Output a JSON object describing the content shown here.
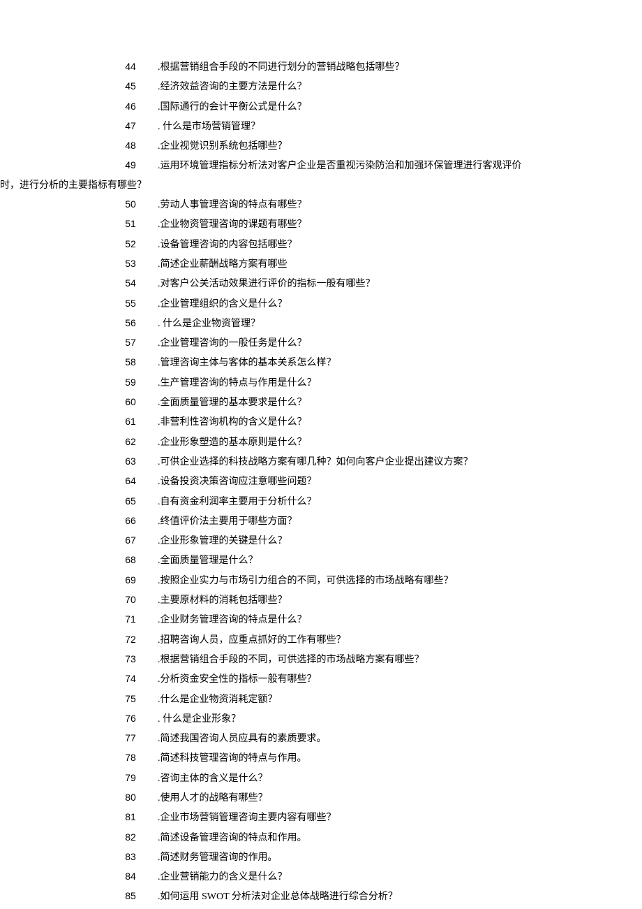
{
  "questions": [
    {
      "num": "44",
      "text": ".根据营销组合手段的不同进行划分的营销战略包括哪些？"
    },
    {
      "num": "45",
      "text": ".经济效益咨询的主要方法是什么？"
    },
    {
      "num": "46",
      "text": ".国际通行的会计平衡公式是什么？"
    },
    {
      "num": "47",
      "text": ". 什么是市场营销管理？"
    },
    {
      "num": "48",
      "text": ".企业视觉识别系统包括哪些？"
    },
    {
      "num": "49",
      "wrap": true,
      "wrap_prefix": "时，",
      "first_line": ".运用环境管理指标分析法对客户企业是否重视污染防治和加强环保管理进行客观评价",
      "second_line": "进行分析的主要指标有哪些？"
    },
    {
      "num": "50",
      "text": ".劳动人事管理咨询的特点有哪些？"
    },
    {
      "num": "51",
      "text": ".企业物资管理咨询的课题有哪些？"
    },
    {
      "num": "52",
      "text": ".设备管理咨询的内容包括哪些？"
    },
    {
      "num": "53",
      "text": ".简述企业薪酬战略方案有哪些"
    },
    {
      "num": "54",
      "text": ".对客户公关活动效果进行评价的指标一般有哪些？"
    },
    {
      "num": "55",
      "text": ".企业管理组织的含义是什么？"
    },
    {
      "num": "56",
      "text": ". 什么是企业物资管理？"
    },
    {
      "num": "57",
      "text": ".企业管理咨询的一般任务是什么？"
    },
    {
      "num": "58",
      "text": ".管理咨询主体与客体的基本关系怎么样？"
    },
    {
      "num": "59",
      "text": ".生产管理咨询的特点与作用是什么？"
    },
    {
      "num": "60",
      "text": ".全面质量管理的基本要求是什么？"
    },
    {
      "num": "61",
      "text": ".非营利性咨询机构的含义是什么？"
    },
    {
      "num": "62",
      "text": ".企业形象塑造的基本原则是什么？"
    },
    {
      "num": "63",
      "text": ".可供企业选择的科技战略方案有哪几种？如何向客户企业提出建议方案？"
    },
    {
      "num": "64",
      "text": ".设备投资决策咨询应注意哪些问题？"
    },
    {
      "num": "65",
      "text": ".自有资金利润率主要用于分析什么？"
    },
    {
      "num": "66",
      "text": ".终值评价法主要用于哪些方面？"
    },
    {
      "num": "67",
      "text": ".企业形象管理的关键是什么？"
    },
    {
      "num": "68",
      "text": ".全面质量管理是什么？"
    },
    {
      "num": "69",
      "text": ".按照企业实力与市场引力组合的不同，可供选择的市场战略有哪些？"
    },
    {
      "num": "70",
      "text": ".主要原材料的消耗包括哪些？"
    },
    {
      "num": "71",
      "text": ".企业财务管理咨询的特点是什么？"
    },
    {
      "num": "72",
      "text": ".招聘咨询人员，应重点抓好的工作有哪些？"
    },
    {
      "num": "73",
      "text": ".根据营销组合手段的不同，可供选择的市场战略方案有哪些？"
    },
    {
      "num": "74",
      "text": ".分析资金安全性的指标一般有哪些？"
    },
    {
      "num": "75",
      "text": ".什么是企业物资消耗定额？"
    },
    {
      "num": "76",
      "text": ". 什么是企业形象？"
    },
    {
      "num": "77",
      "text": ".简述我国咨询人员应具有的素质要求。"
    },
    {
      "num": "78",
      "text": ".简述科技管理咨询的特点与作用。"
    },
    {
      "num": "79",
      "text": ".咨询主体的含义是什么？"
    },
    {
      "num": "80",
      "text": ".使用人才的战略有哪些？"
    },
    {
      "num": "81",
      "text": ".企业市场营销管理咨询主要内容有哪些？"
    },
    {
      "num": "82",
      "text": ".简述设备管理咨询的特点和作用。"
    },
    {
      "num": "83",
      "text": ".简述财务管理咨询的作用。"
    },
    {
      "num": "84",
      "text": ".企业营销能力的含义是什么？"
    },
    {
      "num": "85",
      "text": ".如何运用 SWOT 分析法对企业总体战略进行综合分析？"
    }
  ]
}
